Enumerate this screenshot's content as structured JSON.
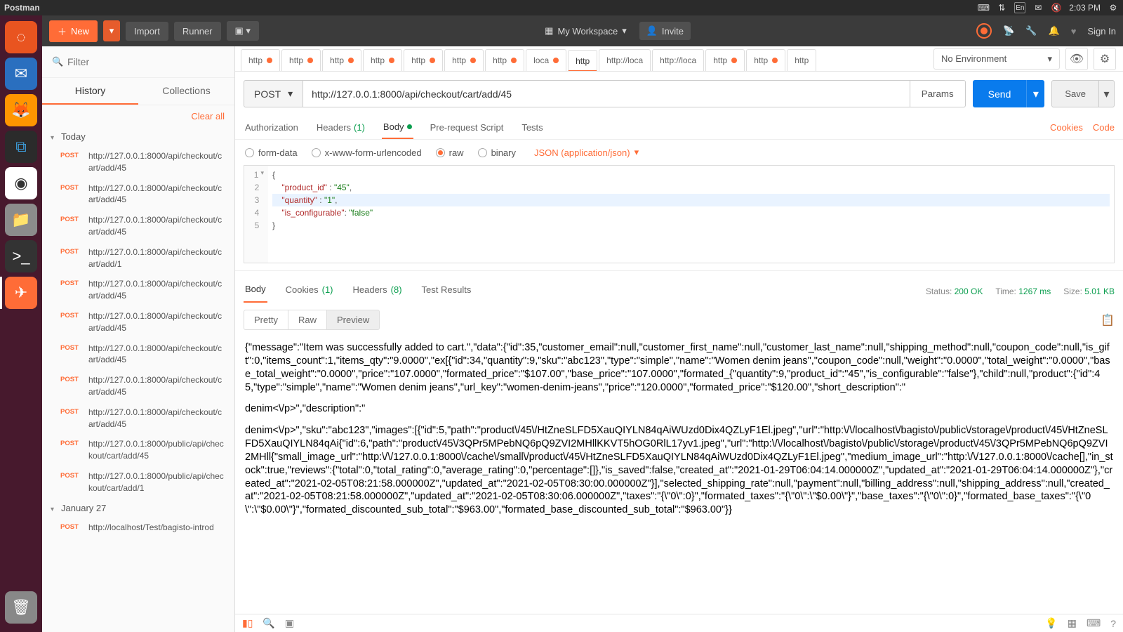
{
  "system": {
    "app_title": "Postman",
    "clock": "2:03 PM",
    "lang": "En"
  },
  "postman_top": {
    "new": "New",
    "import": "Import",
    "runner": "Runner",
    "workspace": "My Workspace",
    "invite": "Invite",
    "signin": "Sign In"
  },
  "sidebar": {
    "filter_placeholder": "Filter",
    "tab_history": "History",
    "tab_collections": "Collections",
    "clear_all": "Clear all",
    "group_today": "Today",
    "group_jan27": "January 27",
    "items": [
      {
        "method": "POST",
        "url": "http://127.0.0.1:8000/api/checkout/cart/add/45"
      },
      {
        "method": "POST",
        "url": "http://127.0.0.1:8000/api/checkout/cart/add/45"
      },
      {
        "method": "POST",
        "url": "http://127.0.0.1:8000/api/checkout/cart/add/45"
      },
      {
        "method": "POST",
        "url": "http://127.0.0.1:8000/api/checkout/cart/add/1"
      },
      {
        "method": "POST",
        "url": "http://127.0.0.1:8000/api/checkout/cart/add/45"
      },
      {
        "method": "POST",
        "url": "http://127.0.0.1:8000/api/checkout/cart/add/45"
      },
      {
        "method": "POST",
        "url": "http://127.0.0.1:8000/api/checkout/cart/add/45"
      },
      {
        "method": "POST",
        "url": "http://127.0.0.1:8000/api/checkout/cart/add/45"
      },
      {
        "method": "POST",
        "url": "http://127.0.0.1:8000/api/checkout/cart/add/45"
      },
      {
        "method": "POST",
        "url": "http://127.0.0.1:8000/public/api/checkout/cart/add/45"
      },
      {
        "method": "POST",
        "url": "http://127.0.0.1:8000/public/api/checkout/cart/add/1"
      }
    ],
    "jan27_items": [
      {
        "method": "POST",
        "url": "http://localhost/Test/bagisto-introd"
      }
    ]
  },
  "tabs": {
    "list": [
      {
        "label": "http",
        "unsaved": true
      },
      {
        "label": "http",
        "unsaved": true
      },
      {
        "label": "http",
        "unsaved": true
      },
      {
        "label": "http",
        "unsaved": true
      },
      {
        "label": "http",
        "unsaved": true
      },
      {
        "label": "http",
        "unsaved": true
      },
      {
        "label": "http",
        "unsaved": true
      },
      {
        "label": "loca",
        "unsaved": true
      },
      {
        "label": "http",
        "unsaved": false,
        "active": true
      },
      {
        "label": "http://loca",
        "unsaved": false
      },
      {
        "label": "http://loca",
        "unsaved": false
      },
      {
        "label": "http",
        "unsaved": true
      },
      {
        "label": "http",
        "unsaved": true
      },
      {
        "label": "http",
        "unsaved": false
      }
    ]
  },
  "env": {
    "label": "No Environment"
  },
  "request": {
    "method": "POST",
    "url": "http://127.0.0.1:8000/api/checkout/cart/add/45",
    "params_btn": "Params",
    "send": "Send",
    "save": "Save",
    "subtabs": {
      "auth": "Authorization",
      "headers": "Headers",
      "headers_count": "(1)",
      "body": "Body",
      "prereq": "Pre-request Script",
      "tests": "Tests"
    },
    "right_links": {
      "cookies": "Cookies",
      "code": "Code"
    },
    "body_types": {
      "formdata": "form-data",
      "urlenc": "x-www-form-urlencoded",
      "raw": "raw",
      "binary": "binary",
      "json_dd": "JSON (application/json)"
    },
    "body_code": {
      "l1": "{",
      "l2_k": "\"product_id\"",
      "l2_v": "\"45\"",
      "l3_k": "\"quantity\"",
      "l3_v": "\"1\"",
      "l4_k": "\"is_configurable\"",
      "l4_v": "\"false\"",
      "l5": "}"
    }
  },
  "response": {
    "tabs": {
      "body": "Body",
      "cookies": "Cookies",
      "cookies_count": "(1)",
      "headers": "Headers",
      "headers_count": "(8)",
      "tests": "Test Results"
    },
    "status_label": "Status:",
    "status_value": "200 OK",
    "time_label": "Time:",
    "time_value": "1267 ms",
    "size_label": "Size:",
    "size_value": "5.01 KB",
    "views": {
      "pretty": "Pretty",
      "raw": "Raw",
      "preview": "Preview"
    },
    "preview_p1": "{\"message\":\"Item was successfully added to cart.\",\"data\":{\"id\":35,\"customer_email\":null,\"customer_first_name\":null,\"customer_last_name\":null,\"shipping_method\":null,\"coupon_code\":null,\"is_gift\":0,\"items_count\":1,\"items_qty\":\"9.0000\",\"ex[{\"id\":34,\"quantity\":9,\"sku\":\"abc123\",\"type\":\"simple\",\"name\":\"Women denim jeans\",\"coupon_code\":null,\"weight\":\"0.0000\",\"total_weight\":\"0.0000\",\"base_total_weight\":\"0.0000\",\"price\":\"107.0000\",\"formated_price\":\"$107.00\",\"base_price\":\"107.0000\",\"formated_{\"quantity\":9,\"product_id\":\"45\",\"is_configurable\":\"false\"},\"child\":null,\"product\":{\"id\":45,\"type\":\"simple\",\"name\":\"Women denim jeans\",\"url_key\":\"women-denim-jeans\",\"price\":\"120.0000\",\"formated_price\":\"$120.00\",\"short_description\":\"",
    "preview_p2": "denim<\\/p>\",\"description\":\"",
    "preview_p3": "denim<\\/p>\",\"sku\":\"abc123\",\"images\":[{\"id\":5,\"path\":\"product\\/45\\/HtZneSLFD5XauQIYLN84qAiWUzd0Dix4QZLyF1El.jpeg\",\"url\":\"http:\\/\\/localhost\\/bagisto\\/public\\/storage\\/product\\/45\\/HtZneSLFD5XauQIYLN84qAi{\"id\":6,\"path\":\"product\\/45\\/3QPr5MPebNQ6pQ9ZVI2MHllKKVT5hOG0RlL17yv1.jpeg\",\"url\":\"http:\\/\\/localhost\\/bagisto\\/public\\/storage\\/product\\/45\\/3QPr5MPebNQ6pQ9ZVI2MHll{\"small_image_url\":\"http:\\/\\/127.0.0.1:8000\\/cache\\/small\\/product\\/45\\/HtZneSLFD5XauQIYLN84qAiWUzd0Dix4QZLyF1El.jpeg\",\"medium_image_url\":\"http:\\/\\/127.0.0.1:8000\\/cache[],\"in_stock\":true,\"reviews\":{\"total\":0,\"total_rating\":0,\"average_rating\":0,\"percentage\":[]},\"is_saved\":false,\"created_at\":\"2021-01-29T06:04:14.000000Z\",\"updated_at\":\"2021-01-29T06:04:14.000000Z\"},\"created_at\":\"2021-02-05T08:21:58.000000Z\",\"updated_at\":\"2021-02-05T08:30:00.000000Z\"}],\"selected_shipping_rate\":null,\"payment\":null,\"billing_address\":null,\"shipping_address\":null,\"created_at\":\"2021-02-05T08:21:58.000000Z\",\"updated_at\":\"2021-02-05T08:30:06.000000Z\",\"taxes\":\"{\\\"0\\\":0}\",\"formated_taxes\":\"{\\\"0\\\":\\\"$0.00\\\"}\",\"base_taxes\":\"{\\\"0\\\":0}\",\"formated_base_taxes\":\"{\\\"0\\\":\\\"$0.00\\\"}\",\"formated_discounted_sub_total\":\"$963.00\",\"formated_base_discounted_sub_total\":\"$963.00\"}}"
  }
}
